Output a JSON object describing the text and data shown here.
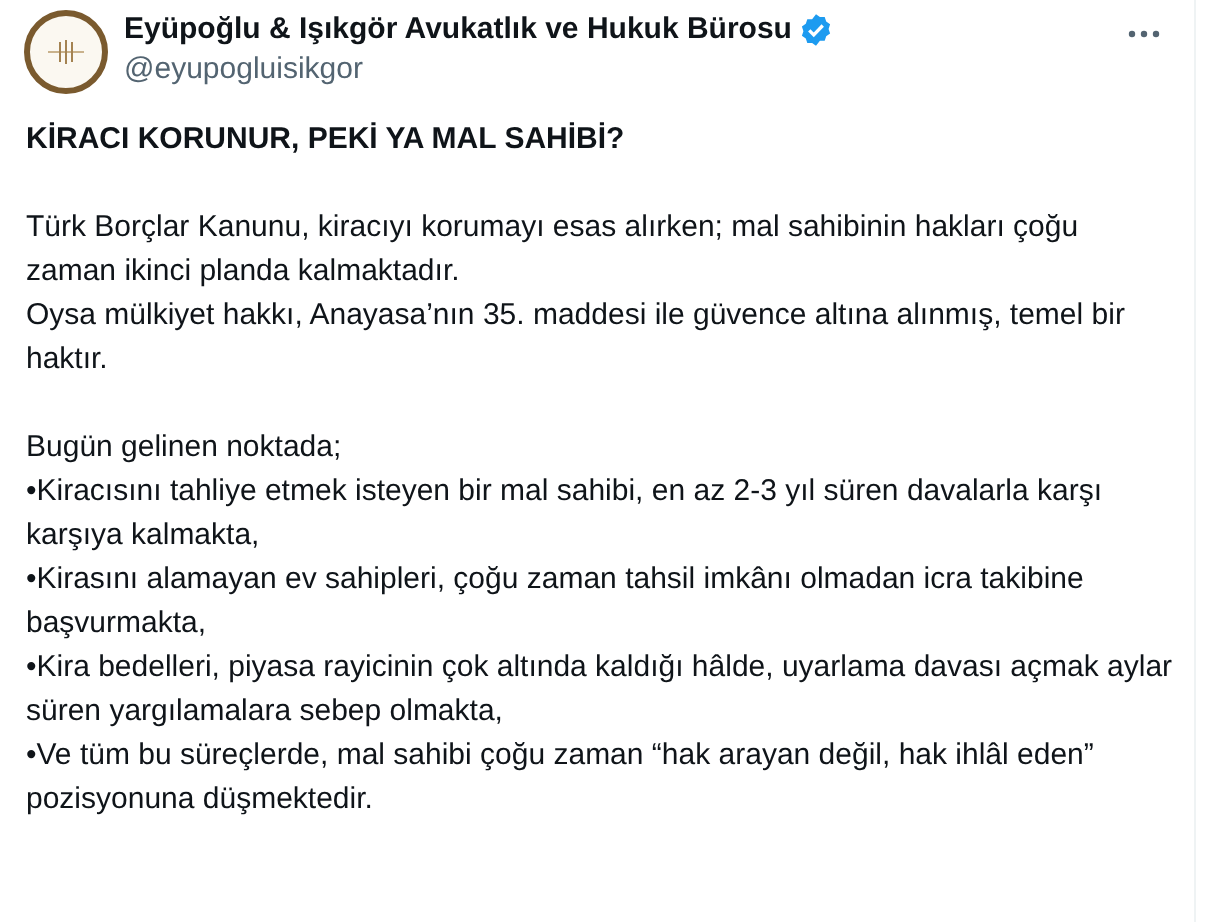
{
  "author": {
    "name": "Eyüpoğlu & Işıkgör Avukatlık ve Hukuk Bürosu",
    "verified": true,
    "handle": "@eyupogluisikgor"
  },
  "post": {
    "title": "KİRACI KORUNUR, PEKİ YA MAL SAHİBİ?",
    "sections": [
      [
        "Türk Borçlar Kanunu, kiracıyı korumayı esas alırken; mal sahibinin hakları çoğu zaman ikinci planda kalmaktadır.",
        "Oysa mülkiyet hakkı, Anayasa’nın 35. maddesi ile güvence altına alınmış, temel bir haktır."
      ],
      [
        "Bugün gelinen noktada;",
        "•Kiracısını tahliye etmek isteyen bir mal sahibi, en az 2-3 yıl süren davalarla karşı karşıya kalmakta,",
        "•Kirasını alamayan ev sahipleri, çoğu zaman tahsil imkânı olmadan icra takibine başvurmakta,",
        "•Kira bedelleri, piyasa rayicinin çok altında kaldığı hâlde, uyarlama davası açmak aylar süren yargılamalara sebep olmakta,",
        "•Ve tüm bu süreçlerde, mal sahibi çoğu zaman “hak arayan değil, hak ihlâl eden” pozisyonuna düşmektedir."
      ]
    ]
  }
}
